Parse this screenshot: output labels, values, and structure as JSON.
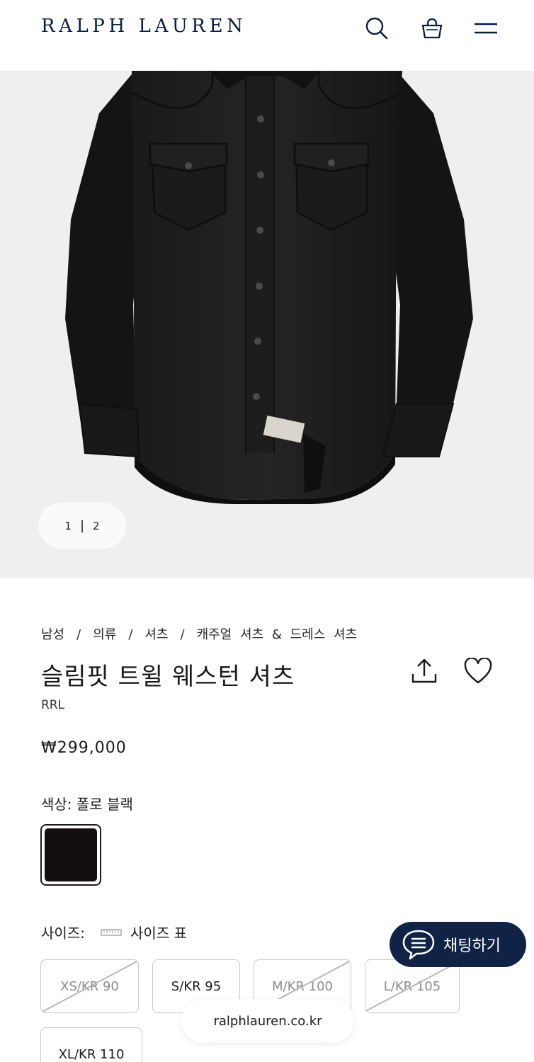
{
  "header": {
    "logo": "RALPH LAUREN",
    "search_icon": "search-icon",
    "bag_icon": "shopping-bag-icon",
    "menu_icon": "menu-icon"
  },
  "gallery": {
    "current": "1",
    "separator": "|",
    "total": "2"
  },
  "product": {
    "breadcrumb": [
      "남성",
      "의류",
      "셔츠",
      "캐주얼 셔츠 & 드레스 셔츠"
    ],
    "breadcrumb_separator": "/",
    "title": "슬림핏 트윌 웨스턴 셔츠",
    "brand": "RRL",
    "price": "₩299,000",
    "color_label": "색상:",
    "color_value": "폴로 블랙",
    "swatch_color": "#150e10"
  },
  "size": {
    "label": "사이즈:",
    "guide_label": "사이즈 표",
    "options": [
      {
        "label": "XS/KR 90",
        "available": false
      },
      {
        "label": "S/KR 95",
        "available": true
      },
      {
        "label": "M/KR 100",
        "available": false
      },
      {
        "label": "L/KR 105",
        "available": false
      },
      {
        "label": "XL/KR 110",
        "available": true
      }
    ]
  },
  "chat": {
    "label": "채팅하기",
    "color": "#102245"
  },
  "browser": {
    "url": "ralphlauren.co.kr"
  },
  "colors": {
    "brand_navy": "#0b1f3f",
    "hero_background": "#efefef"
  }
}
